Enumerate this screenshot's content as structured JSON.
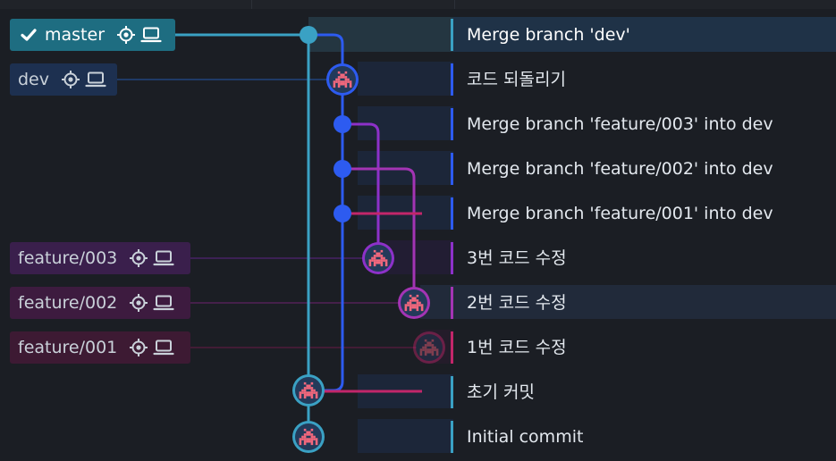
{
  "colors": {
    "background": "#1b1e24",
    "master": "#3aa1c4",
    "dev": "#2d5bf0",
    "feature_003": "#8d31c9",
    "feature_002": "#a334b4",
    "feature_001": "#c2266a",
    "text": "#e3e8ee"
  },
  "branches": [
    {
      "id": "master",
      "label": "master",
      "checked_out": true,
      "icons": [
        "check-icon",
        "target-icon",
        "laptop-icon"
      ]
    },
    {
      "id": "dev",
      "label": "dev",
      "icons": [
        "target-icon",
        "laptop-icon"
      ]
    },
    {
      "id": "f003",
      "label": "feature/003",
      "icons": [
        "target-icon",
        "laptop-icon"
      ]
    },
    {
      "id": "f002",
      "label": "feature/002",
      "icons": [
        "target-icon",
        "laptop-icon"
      ]
    },
    {
      "id": "f001",
      "label": "feature/001",
      "icons": [
        "target-icon",
        "laptop-icon"
      ]
    }
  ],
  "commits": [
    {
      "message": "Merge branch 'dev'",
      "lane": "master",
      "node": "merge-dot",
      "selected": true
    },
    {
      "message": "코드 되돌리기",
      "lane": "dev",
      "node": "avatar"
    },
    {
      "message": "Merge branch 'feature/003' into dev",
      "lane": "dev",
      "node": "merge-dot"
    },
    {
      "message": "Merge branch 'feature/002' into dev",
      "lane": "dev",
      "node": "merge-dot"
    },
    {
      "message": "Merge branch 'feature/001' into dev",
      "lane": "dev",
      "node": "merge-dot"
    },
    {
      "message": "3번 코드 수정",
      "lane": "feature/003",
      "node": "avatar"
    },
    {
      "message": "2번 코드 수정",
      "lane": "feature/002",
      "node": "avatar"
    },
    {
      "message": "1번 코드 수정",
      "lane": "feature/001",
      "node": "avatar",
      "dimmed": true
    },
    {
      "message": "초기 커밋",
      "lane": "master",
      "node": "avatar"
    },
    {
      "message": "Initial commit",
      "lane": "master",
      "node": "avatar"
    }
  ]
}
